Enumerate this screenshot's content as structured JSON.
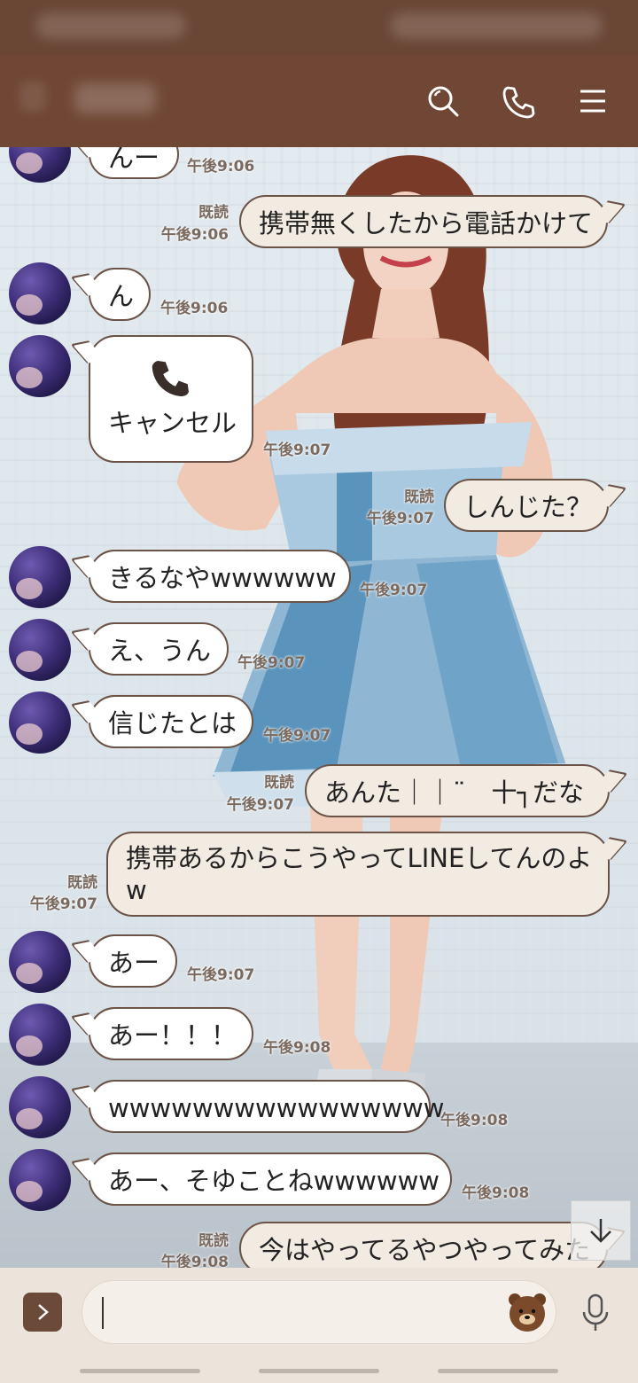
{
  "header": {
    "search_icon": "search-icon",
    "call_icon": "phone-icon",
    "menu_icon": "hamburger-menu-icon"
  },
  "messages": [
    {
      "side": "left",
      "text": "んー",
      "time": "午後9:06"
    },
    {
      "side": "right",
      "text": "携帯無くしたから電話かけて",
      "read": "既読",
      "time": "午後9:06"
    },
    {
      "side": "left",
      "text": "ん",
      "time": "午後9:06"
    },
    {
      "side": "left",
      "type": "call",
      "text": "キャンセル",
      "time": "午後9:07"
    },
    {
      "side": "right",
      "text": "しんじた？",
      "read": "既読",
      "time": "午後9:07"
    },
    {
      "side": "left",
      "text": "きるなやwwwwww",
      "time": "午後9:07"
    },
    {
      "side": "left",
      "text": "え、うん",
      "time": "午後9:07"
    },
    {
      "side": "left",
      "text": "信じたとは",
      "time": "午後9:07"
    },
    {
      "side": "right",
      "text": "あんた｜｜¨　十┐だな",
      "read": "既読",
      "time": "午後9:07"
    },
    {
      "side": "right",
      "text_line1": "携帯あるからこうやってLINEしてんのよ",
      "text_line2": "w",
      "read": "既読",
      "time": "午後9:07"
    },
    {
      "side": "left",
      "text": "あー",
      "time": "午後9:07"
    },
    {
      "side": "left",
      "text": "あー！！！",
      "time": "午後9:08"
    },
    {
      "side": "left",
      "text": "wwwwwwwwwwwwwwww",
      "time": "午後9:08"
    },
    {
      "side": "left",
      "text": "あー、そゆことねwwwwww",
      "time": "午後9:08"
    },
    {
      "side": "right",
      "text": "今はやってるやつやってみた",
      "read": "既読",
      "time": "午後9:08"
    }
  ],
  "input": {
    "placeholder": "",
    "sticker_icon": "bear-sticker-icon",
    "mic_icon": "microphone-icon",
    "menu_icon": "chevron-right-icon"
  },
  "colors": {
    "header_bg": "#704734",
    "bubble_border": "#6b5347",
    "bubble_mine": "#f1ebe2",
    "input_bar": "#ece4da"
  }
}
